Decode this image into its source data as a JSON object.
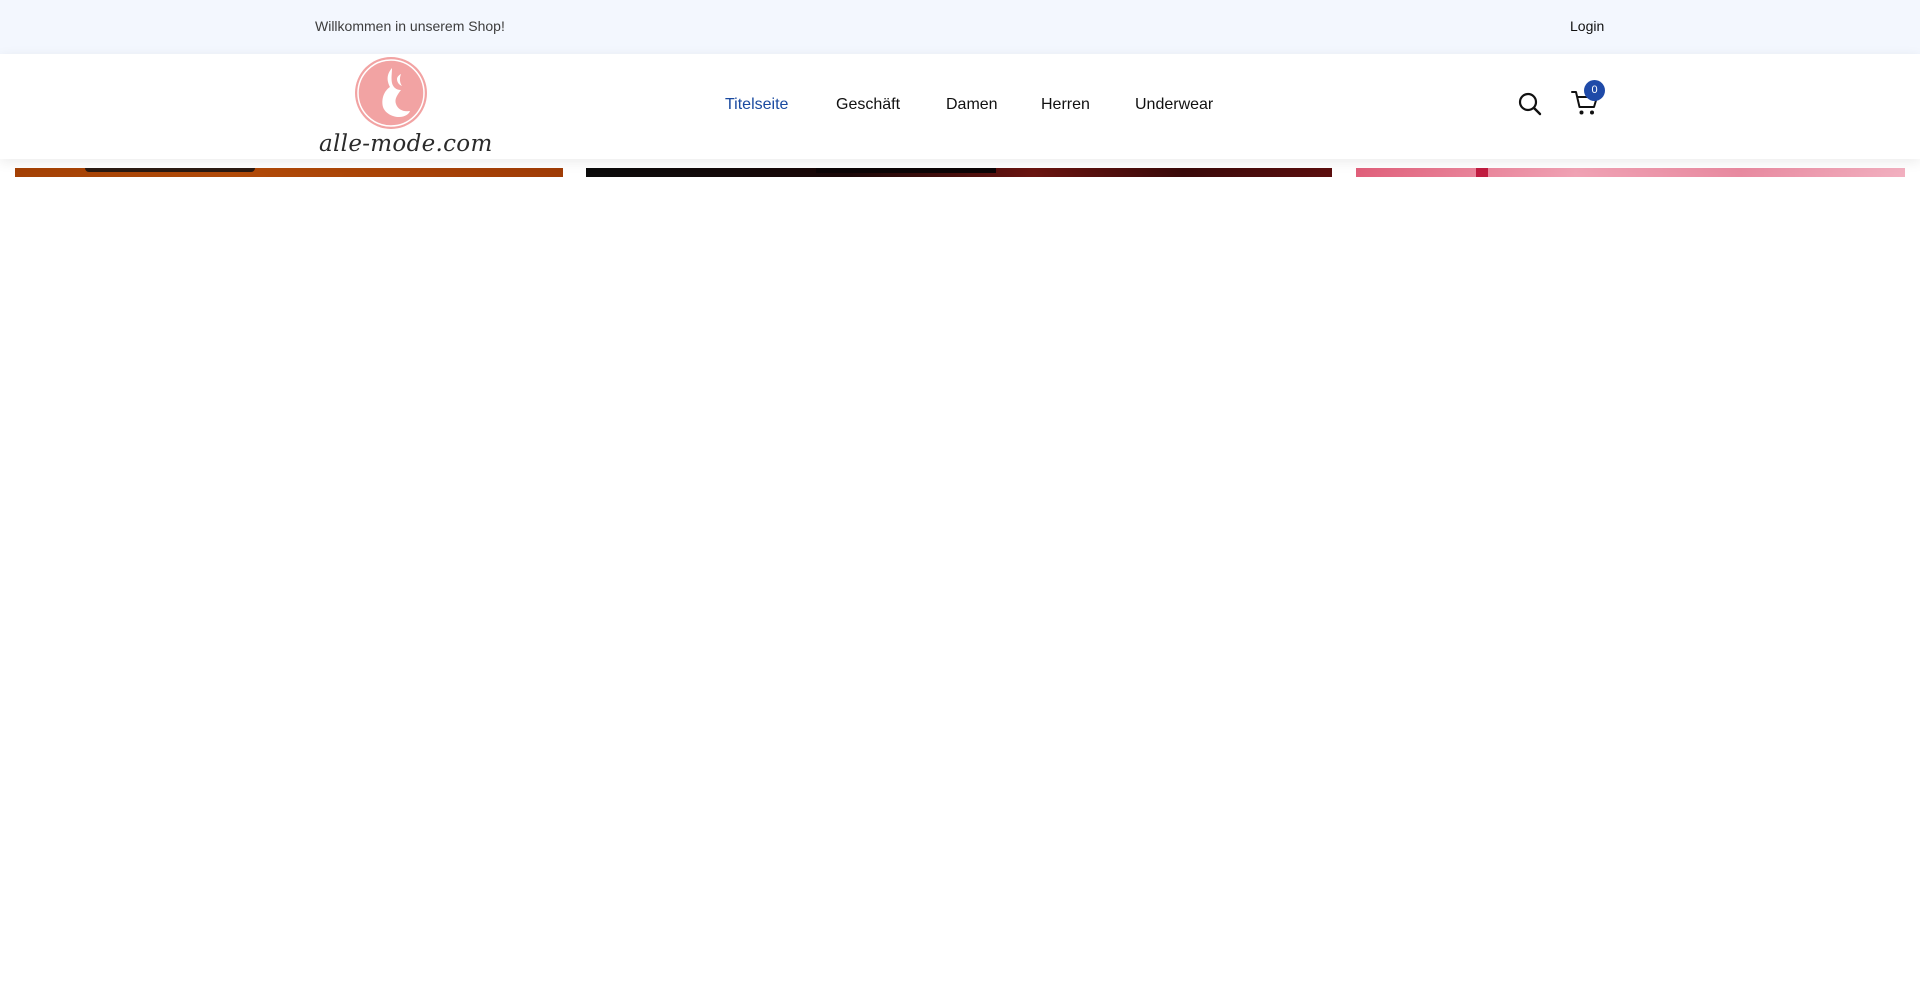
{
  "topbar": {
    "welcome_text": "Willkommen in unserem Shop!",
    "login_label": "Login"
  },
  "header": {
    "logo_text": "alle-mode.com",
    "logo_color": "#f2a3a3",
    "nav": {
      "home": "Titelseite",
      "shop": "Geschäft",
      "women": "Damen",
      "men": "Herren",
      "underwear": "Underwear",
      "active_color": "#1a4aa0"
    },
    "search_icon": "search-icon",
    "cart_icon": "cart-icon",
    "cart_count": "0",
    "badge_color": "#1f4aa8"
  },
  "banners": [
    {
      "name": "banner-1",
      "accent": "#b14a08"
    },
    {
      "name": "banner-2",
      "accent": "#6a1410"
    },
    {
      "name": "banner-3",
      "accent": "#f0a2b4"
    }
  ]
}
